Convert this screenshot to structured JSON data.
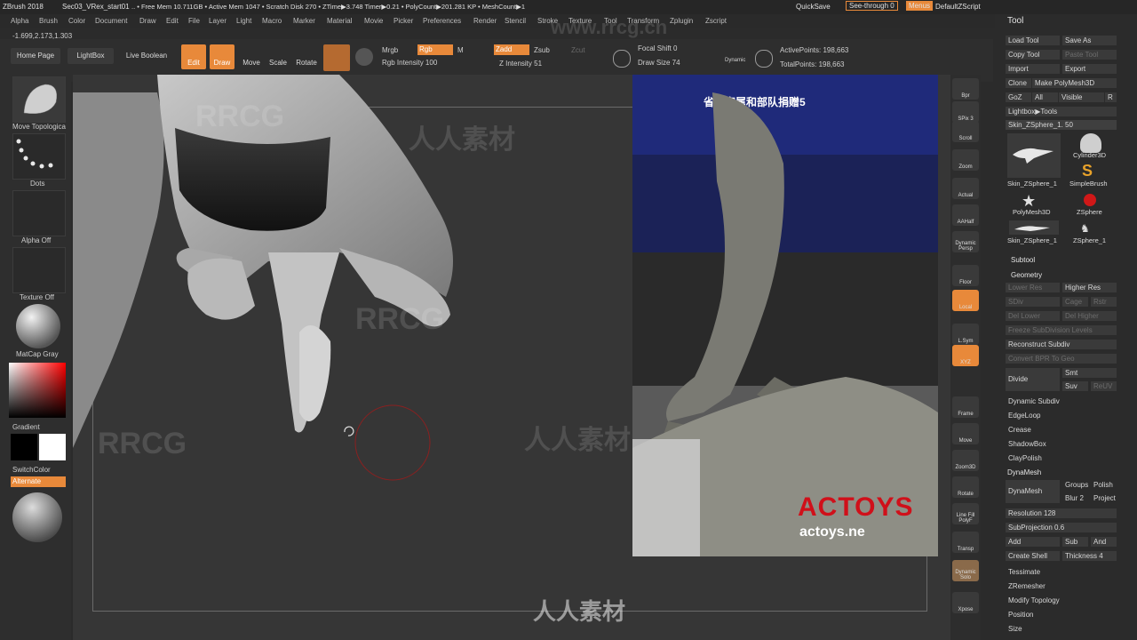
{
  "titlebar": {
    "app": "ZBrush 2018",
    "project": "Sec03_VRex_start01",
    "stats": ".. • Free Mem 10.711GB • Active Mem 1047 • Scratch Disk 270 • ZTime▶3.748 Timer▶0.21 • PolyCount▶201.281 KP • MeshCount▶1",
    "quicksave": "QuickSave",
    "see_through": "See-through  0",
    "menus": "Menus",
    "script": "DefaultZScript"
  },
  "menu": [
    "Alpha",
    "Brush",
    "Color",
    "Document",
    "Draw",
    "Edit",
    "File",
    "Layer",
    "Light",
    "Macro",
    "Marker",
    "Material",
    "Movie",
    "Picker",
    "Preferences",
    "Render",
    "Stencil",
    "Stroke",
    "Texture",
    "Tool",
    "Transform",
    "Zplugin",
    "Zscript"
  ],
  "coords": "-1.699,2.173,1.303",
  "shelf": {
    "home": "Home Page",
    "lightbox": "LightBox",
    "boolean": "Live Boolean",
    "edit": "Edit",
    "draw": "Draw",
    "move": "Move",
    "scale": "Scale",
    "rotate": "Rotate",
    "mrgb": "Mrgb",
    "rgb": "Rgb",
    "m": "M",
    "rgb_intensity": "Rgb Intensity 100",
    "zadd": "Zadd",
    "zsub": "Zsub",
    "zcut": "Zcut",
    "z_intensity": "Z Intensity 51",
    "focal_shift": "Focal Shift 0",
    "draw_size": "Draw Size 74",
    "dynamic": "Dynamic",
    "active_points": "ActivePoints: 198,663",
    "total_points": "TotalPoints: 198,663"
  },
  "left_tray": {
    "brush": "Move Topologica",
    "stroke": "Dots",
    "alpha": "Alpha Off",
    "texture": "Texture Off",
    "material": "MatCap Gray",
    "gradient": "Gradient",
    "switch": "SwitchColor",
    "alternate": "Alternate"
  },
  "right_strip": [
    "Bpr",
    "SPix 3",
    "Scroll",
    "Zoom",
    "Actual",
    "AAHalf",
    "Dynamic Persp",
    "Floor",
    "Local",
    "L.Sym",
    "XYZ",
    "Frame",
    "Move",
    "Zoom3D",
    "Rotate",
    "Line Fill PolyF",
    "Transp",
    "Dynamic Solo",
    "Xpose"
  ],
  "tool_panel": {
    "title": "Tool",
    "load": "Load Tool",
    "save": "Save As",
    "copy": "Copy Tool",
    "paste": "Paste Tool",
    "import": "Import",
    "export": "Export",
    "clone": "Clone",
    "make_poly": "Make PolyMesh3D",
    "goz": "GoZ",
    "all": "All",
    "visible": "Visible",
    "r": "R",
    "lightbox_tools": "Lightbox▶Tools",
    "current_tool": "Skin_ZSphere_1. 50",
    "tools": [
      "Skin_ZSphere_1",
      "Cylinder3D",
      "SimpleBrush",
      "PolyMesh3D",
      "ZSphere",
      "Skin_ZSphere_1",
      "ZSphere_1"
    ],
    "subtool": "Subtool",
    "geometry": "Geometry",
    "lower_res": "Lower Res",
    "higher_res": "Higher Res",
    "sdiv": "SDiv",
    "cage": "Cage",
    "rstr": "Rstr",
    "del_lower": "Del Lower",
    "del_higher": "Del Higher",
    "freeze": "Freeze SubDivision Levels",
    "reconstruct": "Reconstruct Subdiv",
    "convert_bpr": "Convert BPR To Geo",
    "divide": "Divide",
    "smt": "Smt",
    "suv": "Suv",
    "reuv": "ReUV",
    "dynamic_subdiv": "Dynamic Subdiv",
    "edgeloop": "EdgeLoop",
    "crease": "Crease",
    "shadowbox": "ShadowBox",
    "claypolish": "ClayPolish",
    "dynamesh_header": "DynaMesh",
    "dynamesh_btn": "DynaMesh",
    "groups": "Groups",
    "polish": "Polish",
    "blur": "Blur 2",
    "project": "Project",
    "resolution": "Resolution 128",
    "subprojection": "SubProjection 0.6",
    "add": "Add",
    "sub": "Sub",
    "and": "And",
    "create_shell": "Create Shell",
    "thickness": "Thickness 4",
    "tessimate": "Tessimate",
    "zremesher": "ZRemesher",
    "modify_topology": "Modify Topology",
    "position": "Position",
    "size": "Size"
  },
  "reference": {
    "banner": "省家家属和部队捐赠5",
    "logo": "ACTOYS",
    "url": "actoys.ne"
  },
  "watermarks": [
    "www.rrcg.cn",
    "RRCG",
    "人人素材",
    "RRCG",
    "人人素材",
    "RRCG",
    "人人素材"
  ],
  "colors": {
    "accent": "#e8893a",
    "panel": "#2b2b2b",
    "viewport": "#363636"
  }
}
